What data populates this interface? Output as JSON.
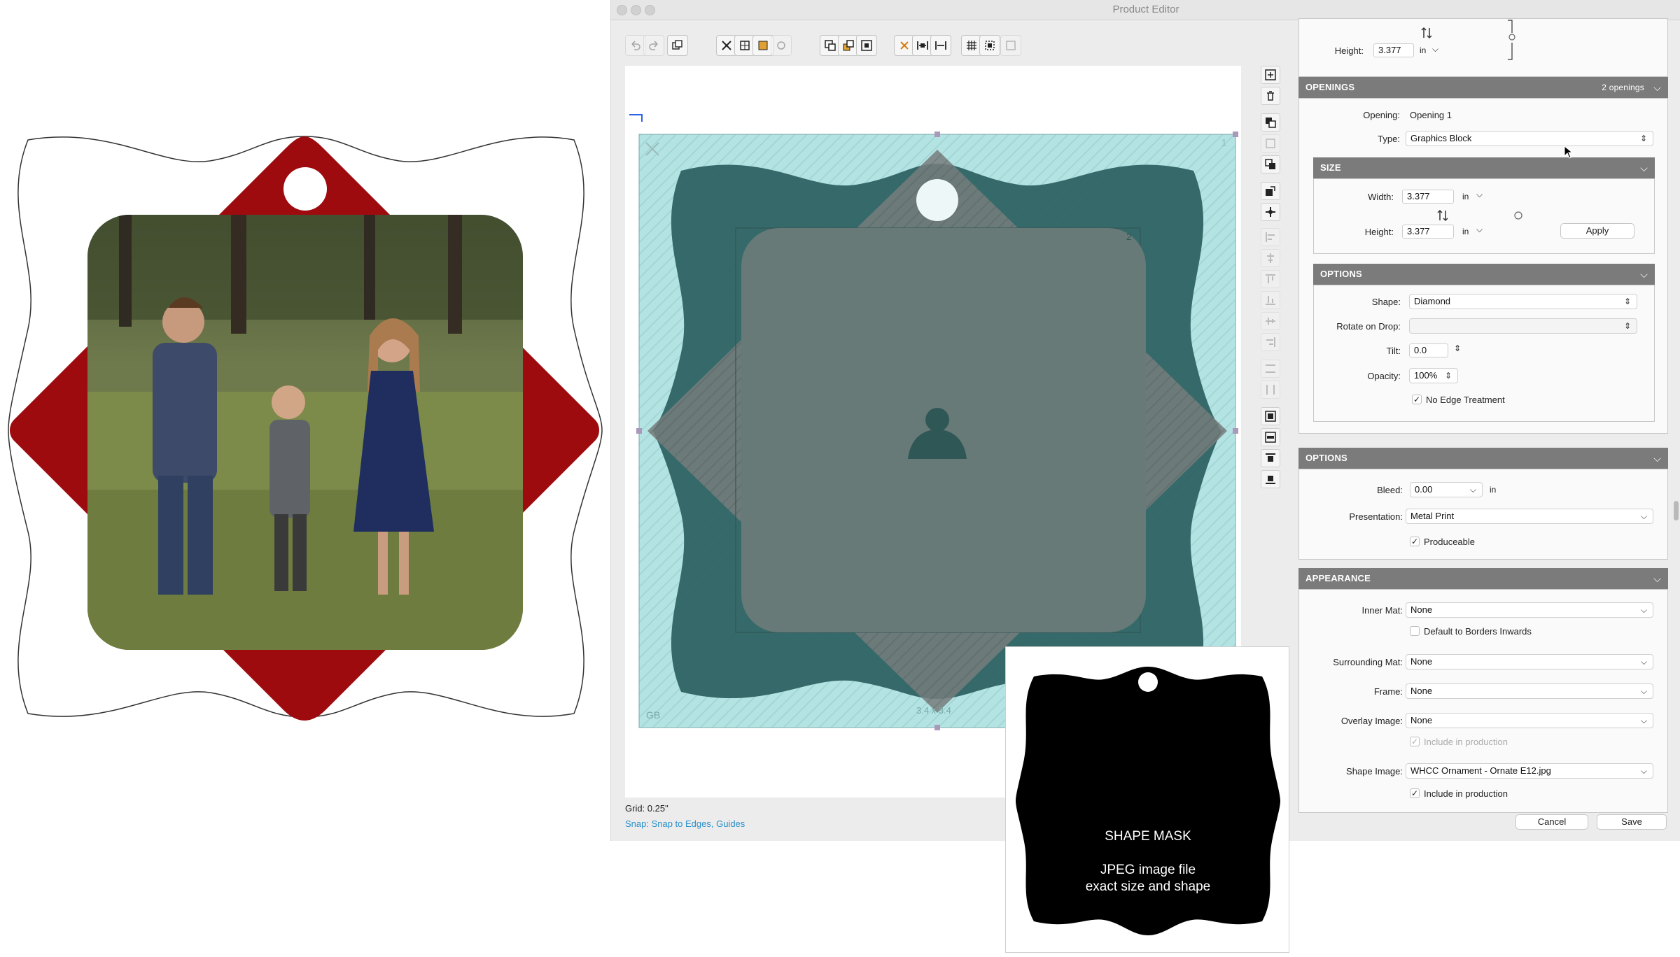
{
  "window": {
    "title": "Product Editor"
  },
  "canvas": {
    "opening_index": "2",
    "page_index": "1",
    "corner_label": "GB",
    "size_label": "3.4 x 3.4"
  },
  "status": {
    "grid": "Grid: 0.25\"",
    "snap": "Snap: Snap to Edges, Guides"
  },
  "top_section": {
    "height_label": "Height:",
    "height_value": "3.377",
    "unit": "in"
  },
  "openings": {
    "title": "OPENINGS",
    "count": "2 openings",
    "opening_label": "Opening:",
    "opening_value": "Opening 1",
    "type_label": "Type:",
    "type_value": "Graphics Block"
  },
  "size": {
    "title": "SIZE",
    "width_label": "Width:",
    "width_value": "3.377",
    "height_label": "Height:",
    "height_value": "3.377",
    "unit": "in",
    "apply_label": "Apply"
  },
  "options1": {
    "title": "OPTIONS",
    "shape_label": "Shape:",
    "shape_value": "Diamond",
    "rotate_label": "Rotate on Drop:",
    "rotate_value": "",
    "tilt_label": "Tilt:",
    "tilt_value": "0.0",
    "opacity_label": "Opacity:",
    "opacity_value": "100%",
    "edge_label": "No Edge Treatment",
    "edge_checked": true
  },
  "options2": {
    "title": "OPTIONS",
    "bleed_label": "Bleed:",
    "bleed_value": "0.00",
    "bleed_unit": "in",
    "presentation_label": "Presentation:",
    "presentation_value": "Metal Print",
    "produceable_label": "Produceable",
    "produceable_checked": true
  },
  "appearance": {
    "title": "APPEARANCE",
    "inner_mat_label": "Inner Mat:",
    "inner_mat_value": "None",
    "default_borders_label": "Default to Borders Inwards",
    "surrounding_mat_label": "Surrounding Mat:",
    "surrounding_mat_value": "None",
    "frame_label": "Frame:",
    "frame_value": "None",
    "overlay_label": "Overlay Image:",
    "overlay_value": "None",
    "overlay_include_label": "Include in production",
    "shape_image_label": "Shape Image:",
    "shape_image_value": "WHCC Ornament - Ornate E12.jpg",
    "shape_include_label": "Include in production"
  },
  "footer": {
    "cancel_label": "Cancel",
    "save_label": "Save"
  },
  "mask_card": {
    "title": "SHAPE MASK",
    "line1": "JPEG image file",
    "line2": "exact size and shape"
  },
  "colors": {
    "ornament_red": "#9e0b0f",
    "canvas_teal": "#b4e3e3",
    "shape_dark_teal": "#2f6363",
    "placeholder_gray": "#677a78",
    "panel_header": "#7b7b7b",
    "snap_link": "#2a8fc9"
  },
  "icons": {
    "person": "person-placeholder-icon",
    "link": "link-icon",
    "swap": "swap-dimensions-icon",
    "chevron": "chevron-down-icon"
  }
}
